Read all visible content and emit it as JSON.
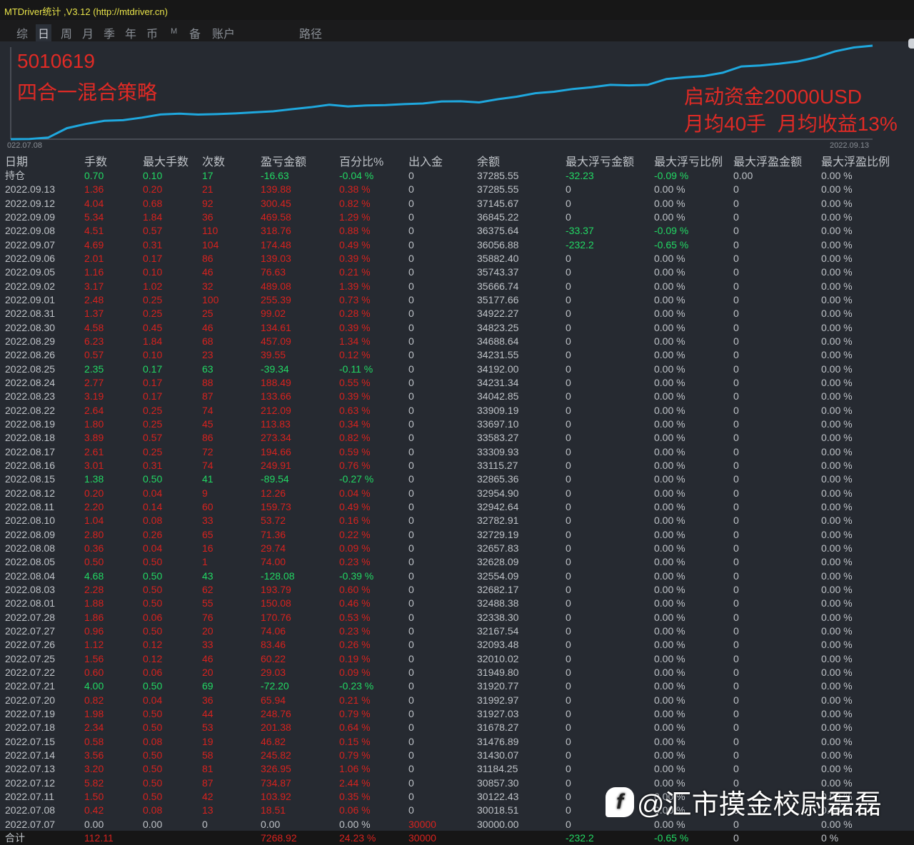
{
  "app": {
    "title": "MTDriver统计 ,V3.12 (http://mtdriver.cn)"
  },
  "tabs": [
    "综",
    "日",
    "周",
    "月",
    "季",
    "年",
    "币",
    "M",
    "备",
    "账户",
    "路径"
  ],
  "active_tab": "日",
  "chart": {
    "account": "5010619",
    "strategy": "四合一混合策略",
    "note1": "启动资金20000USD",
    "note2": "月均40手  月均收益13%",
    "start_label": "022.07.08",
    "end_label": "2022.09.13",
    "line_color": "#1fa8de"
  },
  "headers": [
    "日期",
    "手数",
    "最大手数",
    "次数",
    "盈亏金额",
    "百分比%",
    "出入金",
    "余额",
    "最大浮亏金额",
    "最大浮亏比例",
    "最大浮盈金额",
    "最大浮盈比例"
  ],
  "position": [
    "持仓",
    "0.70",
    "0.10",
    "17",
    "-16.63",
    "-0.04 %",
    "0",
    "37285.55",
    "-32.23",
    "-0.09 %",
    "0.00",
    "0.00 %"
  ],
  "rows": [
    [
      "2022.09.13",
      "1.36",
      "0.20",
      "21",
      "139.88",
      "0.38 %",
      "0",
      "37285.55",
      "0",
      "0.00 %",
      "0",
      "0.00 %"
    ],
    [
      "2022.09.12",
      "4.04",
      "0.68",
      "92",
      "300.45",
      "0.82 %",
      "0",
      "37145.67",
      "0",
      "0.00 %",
      "0",
      "0.00 %"
    ],
    [
      "2022.09.09",
      "5.34",
      "1.84",
      "36",
      "469.58",
      "1.29 %",
      "0",
      "36845.22",
      "0",
      "0.00 %",
      "0",
      "0.00 %"
    ],
    [
      "2022.09.08",
      "4.51",
      "0.57",
      "110",
      "318.76",
      "0.88 %",
      "0",
      "36375.64",
      "-33.37",
      "-0.09 %",
      "0",
      "0.00 %"
    ],
    [
      "2022.09.07",
      "4.69",
      "0.31",
      "104",
      "174.48",
      "0.49 %",
      "0",
      "36056.88",
      "-232.2",
      "-0.65 %",
      "0",
      "0.00 %"
    ],
    [
      "2022.09.06",
      "2.01",
      "0.17",
      "86",
      "139.03",
      "0.39 %",
      "0",
      "35882.40",
      "0",
      "0.00 %",
      "0",
      "0.00 %"
    ],
    [
      "2022.09.05",
      "1.16",
      "0.10",
      "46",
      "76.63",
      "0.21 %",
      "0",
      "35743.37",
      "0",
      "0.00 %",
      "0",
      "0.00 %"
    ],
    [
      "2022.09.02",
      "3.17",
      "1.02",
      "32",
      "489.08",
      "1.39 %",
      "0",
      "35666.74",
      "0",
      "0.00 %",
      "0",
      "0.00 %"
    ],
    [
      "2022.09.01",
      "2.48",
      "0.25",
      "100",
      "255.39",
      "0.73 %",
      "0",
      "35177.66",
      "0",
      "0.00 %",
      "0",
      "0.00 %"
    ],
    [
      "2022.08.31",
      "1.37",
      "0.25",
      "25",
      "99.02",
      "0.28 %",
      "0",
      "34922.27",
      "0",
      "0.00 %",
      "0",
      "0.00 %"
    ],
    [
      "2022.08.30",
      "4.58",
      "0.45",
      "46",
      "134.61",
      "0.39 %",
      "0",
      "34823.25",
      "0",
      "0.00 %",
      "0",
      "0.00 %"
    ],
    [
      "2022.08.29",
      "6.23",
      "1.84",
      "68",
      "457.09",
      "1.34 %",
      "0",
      "34688.64",
      "0",
      "0.00 %",
      "0",
      "0.00 %"
    ],
    [
      "2022.08.26",
      "0.57",
      "0.10",
      "23",
      "39.55",
      "0.12 %",
      "0",
      "34231.55",
      "0",
      "0.00 %",
      "0",
      "0.00 %"
    ],
    [
      "2022.08.25",
      "2.35",
      "0.17",
      "63",
      "-39.34",
      "-0.11 %",
      "0",
      "34192.00",
      "0",
      "0.00 %",
      "0",
      "0.00 %"
    ],
    [
      "2022.08.24",
      "2.77",
      "0.17",
      "88",
      "188.49",
      "0.55 %",
      "0",
      "34231.34",
      "0",
      "0.00 %",
      "0",
      "0.00 %"
    ],
    [
      "2022.08.23",
      "3.19",
      "0.17",
      "87",
      "133.66",
      "0.39 %",
      "0",
      "34042.85",
      "0",
      "0.00 %",
      "0",
      "0.00 %"
    ],
    [
      "2022.08.22",
      "2.64",
      "0.25",
      "74",
      "212.09",
      "0.63 %",
      "0",
      "33909.19",
      "0",
      "0.00 %",
      "0",
      "0.00 %"
    ],
    [
      "2022.08.19",
      "1.80",
      "0.25",
      "45",
      "113.83",
      "0.34 %",
      "0",
      "33697.10",
      "0",
      "0.00 %",
      "0",
      "0.00 %"
    ],
    [
      "2022.08.18",
      "3.89",
      "0.57",
      "86",
      "273.34",
      "0.82 %",
      "0",
      "33583.27",
      "0",
      "0.00 %",
      "0",
      "0.00 %"
    ],
    [
      "2022.08.17",
      "2.61",
      "0.25",
      "72",
      "194.66",
      "0.59 %",
      "0",
      "33309.93",
      "0",
      "0.00 %",
      "0",
      "0.00 %"
    ],
    [
      "2022.08.16",
      "3.01",
      "0.31",
      "74",
      "249.91",
      "0.76 %",
      "0",
      "33115.27",
      "0",
      "0.00 %",
      "0",
      "0.00 %"
    ],
    [
      "2022.08.15",
      "1.38",
      "0.50",
      "41",
      "-89.54",
      "-0.27 %",
      "0",
      "32865.36",
      "0",
      "0.00 %",
      "0",
      "0.00 %"
    ],
    [
      "2022.08.12",
      "0.20",
      "0.04",
      "9",
      "12.26",
      "0.04 %",
      "0",
      "32954.90",
      "0",
      "0.00 %",
      "0",
      "0.00 %"
    ],
    [
      "2022.08.11",
      "2.20",
      "0.14",
      "60",
      "159.73",
      "0.49 %",
      "0",
      "32942.64",
      "0",
      "0.00 %",
      "0",
      "0.00 %"
    ],
    [
      "2022.08.10",
      "1.04",
      "0.08",
      "33",
      "53.72",
      "0.16 %",
      "0",
      "32782.91",
      "0",
      "0.00 %",
      "0",
      "0.00 %"
    ],
    [
      "2022.08.09",
      "2.80",
      "0.26",
      "65",
      "71.36",
      "0.22 %",
      "0",
      "32729.19",
      "0",
      "0.00 %",
      "0",
      "0.00 %"
    ],
    [
      "2022.08.08",
      "0.36",
      "0.04",
      "16",
      "29.74",
      "0.09 %",
      "0",
      "32657.83",
      "0",
      "0.00 %",
      "0",
      "0.00 %"
    ],
    [
      "2022.08.05",
      "0.50",
      "0.50",
      "1",
      "74.00",
      "0.23 %",
      "0",
      "32628.09",
      "0",
      "0.00 %",
      "0",
      "0.00 %"
    ],
    [
      "2022.08.04",
      "4.68",
      "0.50",
      "43",
      "-128.08",
      "-0.39 %",
      "0",
      "32554.09",
      "0",
      "0.00 %",
      "0",
      "0.00 %"
    ],
    [
      "2022.08.03",
      "2.28",
      "0.50",
      "62",
      "193.79",
      "0.60 %",
      "0",
      "32682.17",
      "0",
      "0.00 %",
      "0",
      "0.00 %"
    ],
    [
      "2022.08.01",
      "1.88",
      "0.50",
      "55",
      "150.08",
      "0.46 %",
      "0",
      "32488.38",
      "0",
      "0.00 %",
      "0",
      "0.00 %"
    ],
    [
      "2022.07.28",
      "1.86",
      "0.06",
      "76",
      "170.76",
      "0.53 %",
      "0",
      "32338.30",
      "0",
      "0.00 %",
      "0",
      "0.00 %"
    ],
    [
      "2022.07.27",
      "0.96",
      "0.50",
      "20",
      "74.06",
      "0.23 %",
      "0",
      "32167.54",
      "0",
      "0.00 %",
      "0",
      "0.00 %"
    ],
    [
      "2022.07.26",
      "1.12",
      "0.12",
      "33",
      "83.46",
      "0.26 %",
      "0",
      "32093.48",
      "0",
      "0.00 %",
      "0",
      "0.00 %"
    ],
    [
      "2022.07.25",
      "1.56",
      "0.12",
      "46",
      "60.22",
      "0.19 %",
      "0",
      "32010.02",
      "0",
      "0.00 %",
      "0",
      "0.00 %"
    ],
    [
      "2022.07.22",
      "0.60",
      "0.06",
      "20",
      "29.03",
      "0.09 %",
      "0",
      "31949.80",
      "0",
      "0.00 %",
      "0",
      "0.00 %"
    ],
    [
      "2022.07.21",
      "4.00",
      "0.50",
      "69",
      "-72.20",
      "-0.23 %",
      "0",
      "31920.77",
      "0",
      "0.00 %",
      "0",
      "0.00 %"
    ],
    [
      "2022.07.20",
      "0.82",
      "0.04",
      "36",
      "65.94",
      "0.21 %",
      "0",
      "31992.97",
      "0",
      "0.00 %",
      "0",
      "0.00 %"
    ],
    [
      "2022.07.19",
      "1.98",
      "0.50",
      "44",
      "248.76",
      "0.79 %",
      "0",
      "31927.03",
      "0",
      "0.00 %",
      "0",
      "0.00 %"
    ],
    [
      "2022.07.18",
      "2.34",
      "0.50",
      "53",
      "201.38",
      "0.64 %",
      "0",
      "31678.27",
      "0",
      "0.00 %",
      "0",
      "0.00 %"
    ],
    [
      "2022.07.15",
      "0.58",
      "0.08",
      "19",
      "46.82",
      "0.15 %",
      "0",
      "31476.89",
      "0",
      "0.00 %",
      "0",
      "0.00 %"
    ],
    [
      "2022.07.14",
      "3.56",
      "0.50",
      "58",
      "245.82",
      "0.79 %",
      "0",
      "31430.07",
      "0",
      "0.00 %",
      "0",
      "0.00 %"
    ],
    [
      "2022.07.13",
      "3.20",
      "0.50",
      "81",
      "326.95",
      "1.06 %",
      "0",
      "31184.25",
      "0",
      "0.00 %",
      "0",
      "0.00 %"
    ],
    [
      "2022.07.12",
      "5.82",
      "0.50",
      "87",
      "734.87",
      "2.44 %",
      "0",
      "30857.30",
      "0",
      "0.00 %",
      "0",
      "0.00 %"
    ],
    [
      "2022.07.11",
      "1.50",
      "0.50",
      "42",
      "103.92",
      "0.35 %",
      "0",
      "30122.43",
      "0",
      "0.00 %",
      "0",
      "0.00 %"
    ],
    [
      "2022.07.08",
      "0.42",
      "0.08",
      "13",
      "18.51",
      "0.06 %",
      "0",
      "30018.51",
      "0",
      "0.00 %",
      "0",
      "0.00 %"
    ],
    [
      "2022.07.07",
      "0.00",
      "0.00",
      "0",
      "0.00",
      "0.00 %",
      "30000",
      "30000.00",
      "0",
      "0.00 %",
      "0",
      "0.00 %"
    ]
  ],
  "total": [
    "合计",
    "112.11",
    "",
    "",
    "7268.92",
    "24.23 %",
    "30000",
    "",
    "-232.2",
    "-0.65 %",
    "0",
    "0 %"
  ],
  "watermark": "@汇市摸金校尉磊磊",
  "colors": {
    "profit": "#d8221e",
    "loss": "#22d964",
    "neutral": "#bfc3c8"
  }
}
